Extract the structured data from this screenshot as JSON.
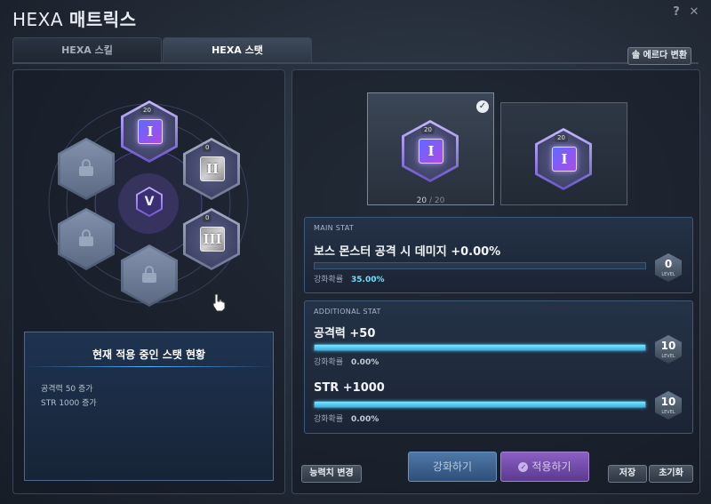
{
  "window": {
    "title_prefix": "HEXA",
    "title_main": "매트릭스",
    "help_label": "?",
    "close_label": "✕"
  },
  "tabs": [
    {
      "label": "HEXA 스킬"
    },
    {
      "label": "HEXA 스탯"
    }
  ],
  "sol_erda_button": "솔 에르다 변환",
  "matrix": {
    "core_level": "20",
    "slot_levels": [
      "0",
      "0"
    ],
    "center_glyph": "V",
    "core_glyph": "I",
    "slot_glyphs": [
      "II",
      "III"
    ]
  },
  "current_status": {
    "title": "현재 적용 중인 스탯 현황",
    "lines": [
      "공격력 50 증가",
      "STR 1000 증가"
    ]
  },
  "cores": {
    "selected_level": "20",
    "other_level": "20",
    "progress_current": "20",
    "progress_separator": "/",
    "progress_max": "20",
    "check_icon": "✓"
  },
  "main_stat": {
    "header": "MAIN STAT",
    "name": "보스 몬스터 공격 시 데미지 +0.00%",
    "rate_label": "강화확률",
    "rate_value": "35.00%",
    "level": "0",
    "level_label": "LEVEL",
    "fill": 0
  },
  "additional_stat": {
    "header": "ADDITIONAL STAT",
    "items": [
      {
        "name": "공격력 +50",
        "rate_label": "강화확률",
        "rate_value": "0.00%",
        "level": "10",
        "level_label": "LEVEL",
        "fill": 1.0
      },
      {
        "name": "STR +1000",
        "rate_label": "강화확률",
        "rate_value": "0.00%",
        "level": "10",
        "level_label": "LEVEL",
        "fill": 1.0
      }
    ]
  },
  "buttons": {
    "change_ability": "능력치 변경",
    "enhance": "강화하기",
    "apply": "적용하기",
    "save": "저장",
    "reset": "초기화"
  },
  "colors": {
    "accent_cyan": "#56d4ff",
    "enhance_button": "#3d6a9b",
    "apply_button": "#7a4cb0"
  }
}
